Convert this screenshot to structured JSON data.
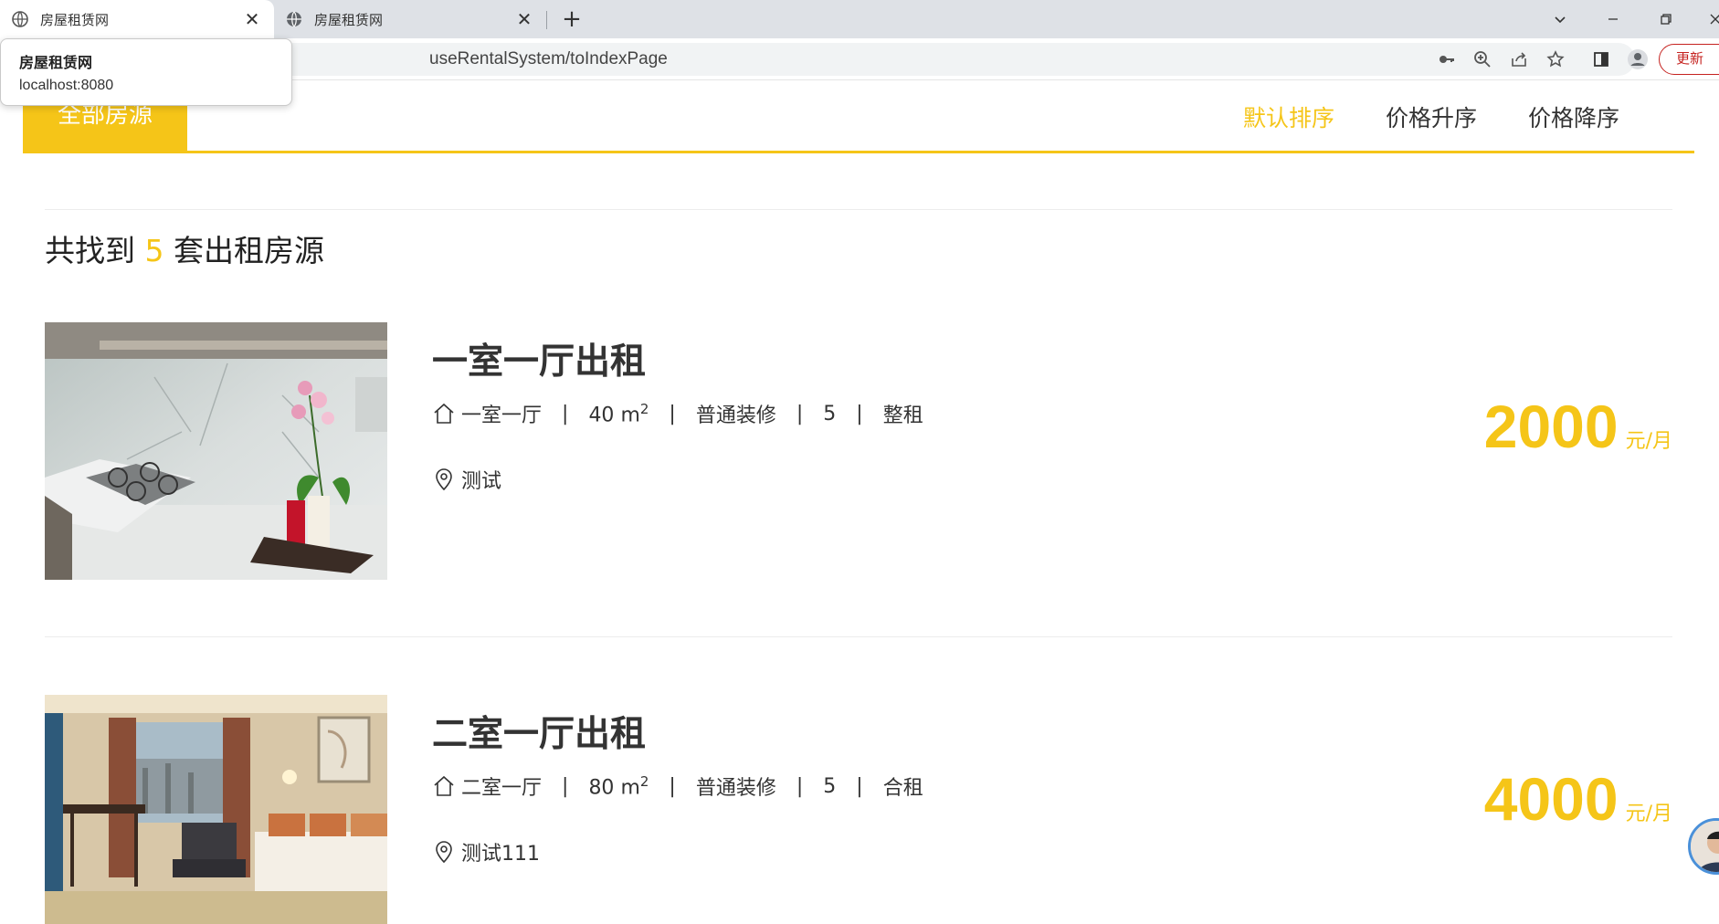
{
  "browser": {
    "tabs": [
      {
        "title": "房屋租赁网",
        "active": true
      },
      {
        "title": "房屋租赁网",
        "active": false
      }
    ],
    "url": "useRentalSystem/toIndexPage",
    "update_label": "更新",
    "tooltip": {
      "title": "房屋租赁网",
      "host": "localhost:8080"
    }
  },
  "filter": {
    "all_label": "全部房源",
    "sorts": [
      "默认排序",
      "价格升序",
      "价格降序"
    ],
    "active_sort_index": 0
  },
  "summary": {
    "prefix": "共找到",
    "count": "5",
    "suffix": "套出租房源"
  },
  "listings": [
    {
      "title": "一室一厅出租",
      "layout": "一室一厅",
      "area": "40",
      "area_unit": "m",
      "area_exp": "2",
      "decoration": "普通装修",
      "floor": "5",
      "rent_type": "整租",
      "location": "测试",
      "price": "2000",
      "price_unit": "元/月"
    },
    {
      "title": "二室一厅出租",
      "layout": "二室一厅",
      "area": "80",
      "area_unit": "m",
      "area_exp": "2",
      "decoration": "普通装修",
      "floor": "5",
      "rent_type": "合租",
      "location": "测试111",
      "price": "4000",
      "price_unit": "元/月"
    }
  ],
  "colors": {
    "accent": "#f5c518",
    "text": "#333333",
    "update_red": "#c5221f"
  }
}
